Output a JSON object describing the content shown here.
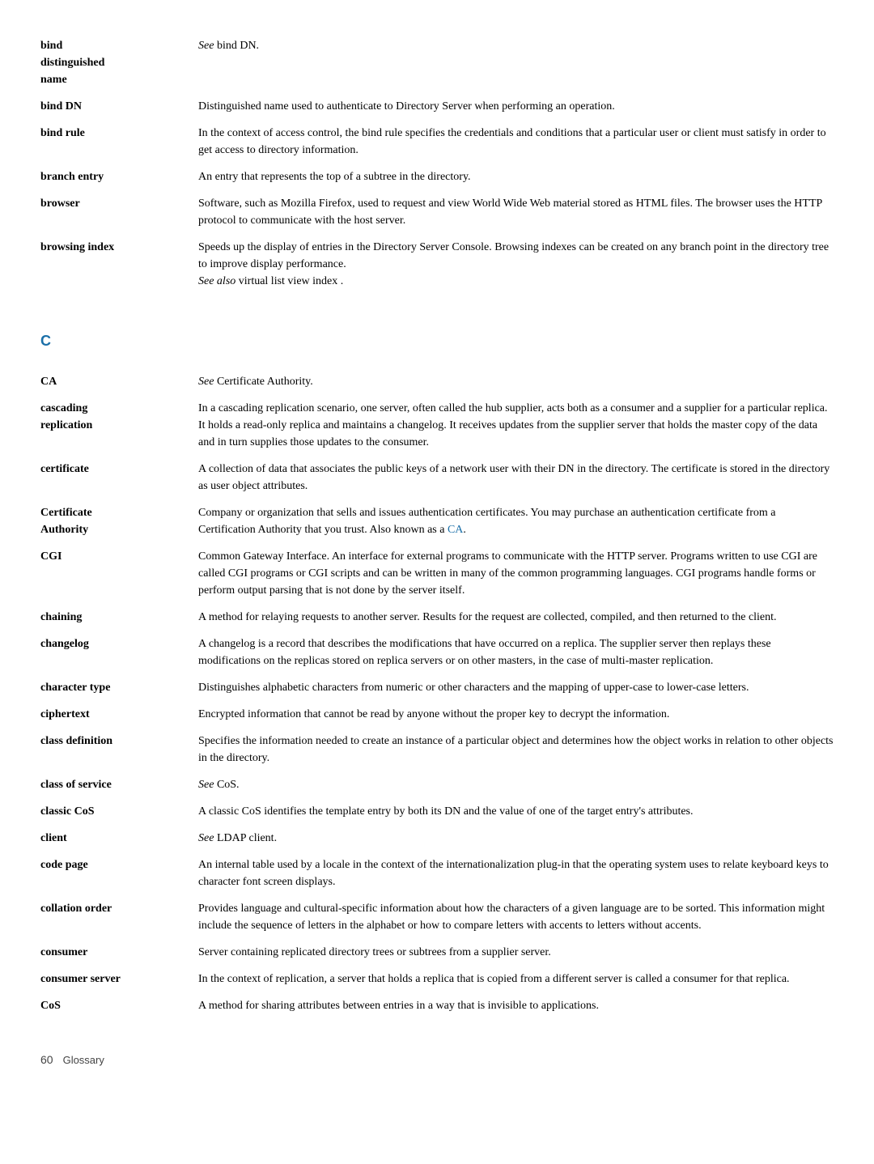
{
  "page": {
    "footer_page": "60",
    "footer_label": "Glossary"
  },
  "sections": [
    {
      "header": null,
      "entries": [
        {
          "term": "bind\ndistinguished\nname",
          "term_display": "bind<br>distinguished<br>name",
          "definition": "<em>See</em> bind DN."
        },
        {
          "term": "bind DN",
          "definition": "Distinguished name used to authenticate to Directory Server when performing an operation."
        },
        {
          "term": "bind rule",
          "definition": "In the context of access control, the bind rule specifies the credentials and conditions that a particular user or client must satisfy in order to get access to directory information."
        },
        {
          "term": "branch entry",
          "definition": "An entry that represents the top of a subtree in the directory."
        },
        {
          "term": "browser",
          "definition": "Software, such as Mozilla Firefox, used to request and view World Wide Web material stored as HTML files. The browser uses the HTTP protocol to communicate with the host server."
        },
        {
          "term": "browsing index",
          "definition": "Speeds up the display of entries in the Directory Server Console. Browsing indexes can be created on any branch point in the directory tree to improve display performance.<br><em>See also</em> virtual list view index ."
        }
      ]
    },
    {
      "header": "C",
      "entries": [
        {
          "term": "CA",
          "definition": "<em>See</em> Certificate Authority."
        },
        {
          "term": "cascading\nreplication",
          "term_display": "cascading<br>replication",
          "definition": "In a cascading replication scenario, one server, often called the hub supplier, acts both as a consumer and a supplier for a particular replica. It holds a read-only replica and maintains a changelog. It receives updates from the supplier server that holds the master copy of the data and in turn supplies those updates to the consumer."
        },
        {
          "term": "certificate",
          "definition": "A collection of data that associates the public keys of a network user with their DN in the directory. The certificate is stored in the directory as user object attributes."
        },
        {
          "term": "Certificate\nAuthority",
          "term_display": "Certificate<br>Authority",
          "definition": "Company or organization that sells and issues authentication certificates. You may purchase an authentication certificate from a Certification Authority that you trust. Also known as a <a>CA</a>."
        },
        {
          "term": "CGI",
          "definition": "Common Gateway Interface. An interface for external programs to communicate with the HTTP server. Programs written to use CGI are called CGI programs or CGI scripts and can be written in many of the common programming languages. CGI programs handle forms or perform output parsing that is not done by the server itself."
        },
        {
          "term": "chaining",
          "definition": "A method for relaying requests to another server. Results for the request are collected, compiled, and then returned to the client."
        },
        {
          "term": "changelog",
          "definition": "A changelog is a record that describes the modifications that have occurred on a replica. The supplier server then replays these modifications on the replicas stored on replica servers or on other masters, in the case of multi-master replication."
        },
        {
          "term": "character type",
          "definition": "Distinguishes alphabetic characters from numeric or other characters and the mapping of upper-case to lower-case letters."
        },
        {
          "term": "ciphertext",
          "definition": "Encrypted information that cannot be read by anyone without the proper key to decrypt the information."
        },
        {
          "term": "class definition",
          "definition": "Specifies the information needed to create an instance of a particular object and determines how the object works in relation to other objects in the directory."
        },
        {
          "term": "class of service",
          "definition": "<em>See</em> CoS."
        },
        {
          "term": "classic CoS",
          "definition": "A classic CoS identifies the template entry by both its DN and the value of one of the target entry's attributes."
        },
        {
          "term": "client",
          "definition": "<em>See</em> LDAP client."
        },
        {
          "term": "code page",
          "definition": "An internal table used by a locale in the context of the internationalization plug-in that the operating system uses to relate keyboard keys to character font screen displays."
        },
        {
          "term": "collation order",
          "definition": "Provides language and cultural-specific information about how the characters of a given language are to be sorted. This information might include the sequence of letters in the alphabet or how to compare letters with accents to letters without accents."
        },
        {
          "term": "consumer",
          "definition": "Server containing replicated directory trees or subtrees from a supplier server."
        },
        {
          "term": "consumer server",
          "definition": "In the context of replication, a server that holds a replica that is copied from a different server is called a consumer for that replica."
        },
        {
          "term": "CoS",
          "definition": "A method for sharing attributes between entries in a way that is invisible to applications."
        }
      ]
    }
  ]
}
